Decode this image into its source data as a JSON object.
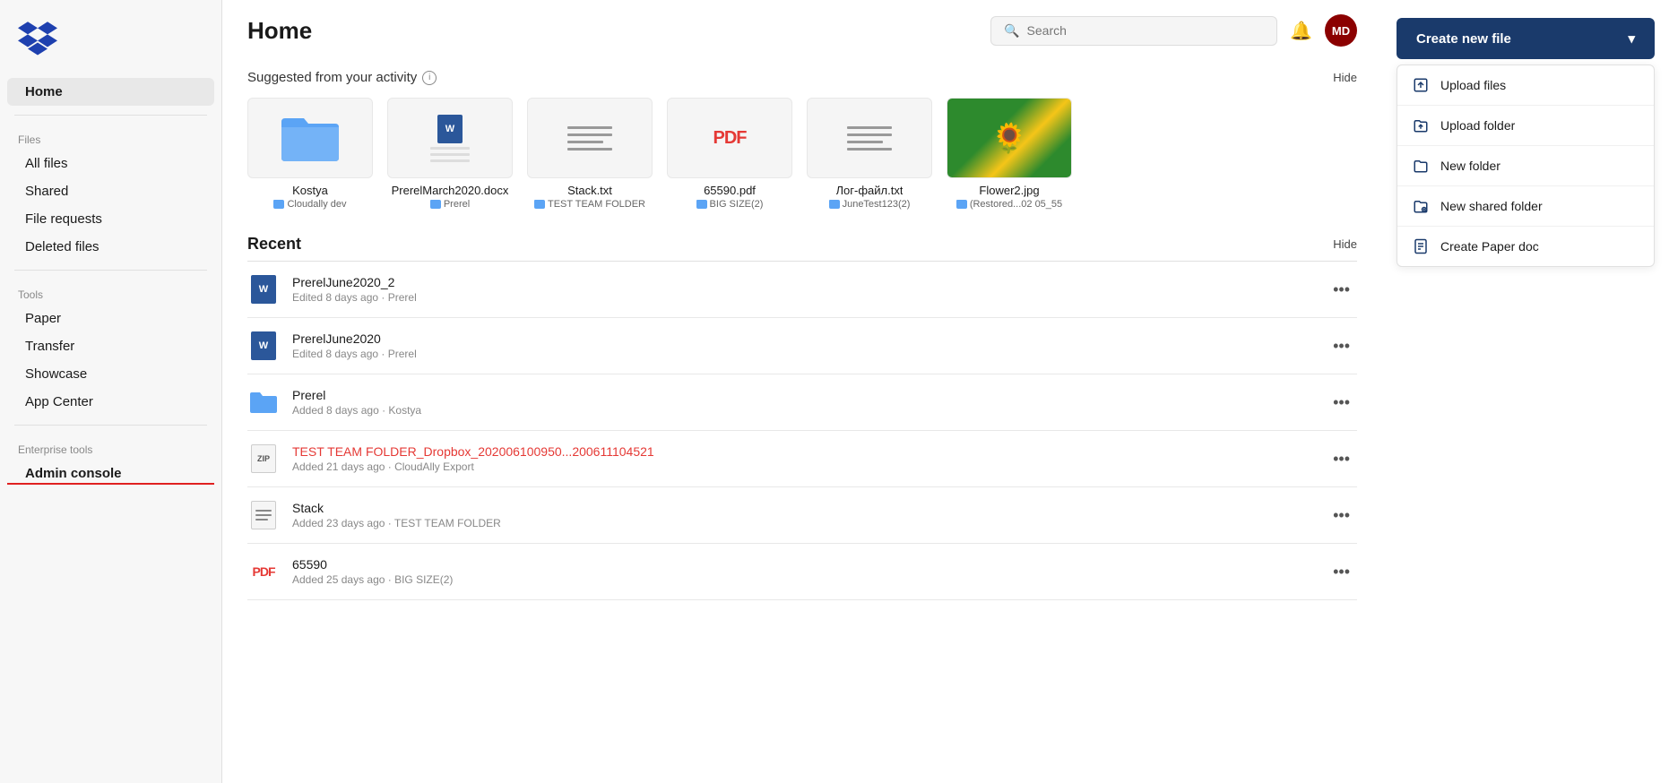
{
  "sidebar": {
    "logo_alt": "Dropbox logo",
    "home_label": "Home",
    "files_section": "Files",
    "items": [
      {
        "id": "all-files",
        "label": "All files"
      },
      {
        "id": "shared",
        "label": "Shared"
      },
      {
        "id": "file-requests",
        "label": "File requests"
      },
      {
        "id": "deleted-files",
        "label": "Deleted files"
      }
    ],
    "tools_section": "Tools",
    "tools": [
      {
        "id": "paper",
        "label": "Paper"
      },
      {
        "id": "transfer",
        "label": "Transfer"
      },
      {
        "id": "showcase",
        "label": "Showcase"
      },
      {
        "id": "app-center",
        "label": "App Center"
      }
    ],
    "enterprise_section": "Enterprise tools",
    "enterprise": [
      {
        "id": "admin-console",
        "label": "Admin console"
      }
    ]
  },
  "topbar": {
    "page_title": "Home",
    "search_placeholder": "Search",
    "avatar_initials": "MD",
    "avatar_color": "#8b0000"
  },
  "suggested": {
    "section_title": "Suggested from your activity",
    "hide_label": "Hide",
    "files": [
      {
        "id": "kostya",
        "name": "Kostya",
        "location": "Cloudally dev",
        "type": "folder"
      },
      {
        "id": "prerel-march",
        "name": "PrerelMarch2020.docx",
        "location": "Prerel",
        "type": "docx"
      },
      {
        "id": "stack-txt",
        "name": "Stack.txt",
        "location": "TEST TEAM FOLDER",
        "type": "txt"
      },
      {
        "id": "pdf-65590",
        "name": "65590.pdf",
        "location": "BIG SIZE(2)",
        "type": "pdf"
      },
      {
        "id": "log-file",
        "name": "Лог-файл.txt",
        "location": "JuneTest123(2)",
        "type": "txt"
      },
      {
        "id": "flower2",
        "name": "Flower2.jpg",
        "location": "(Restored...02 05_55",
        "type": "jpg"
      }
    ]
  },
  "recent": {
    "section_title": "Recent",
    "hide_label": "Hide",
    "items": [
      {
        "id": "prerel-june-2",
        "name": "PrerelJune2020_2",
        "meta": "Edited 8 days ago · Prerel",
        "type": "docx"
      },
      {
        "id": "prerel-june",
        "name": "PrerelJune2020",
        "meta": "Edited 8 days ago · Prerel",
        "type": "docx"
      },
      {
        "id": "prerel-folder",
        "name": "Prerel",
        "meta": "Added 8 days ago · Kostya",
        "type": "folder"
      },
      {
        "id": "test-team-folder",
        "name": "TEST TEAM FOLDER_Dropbox_202006100950...200611104521",
        "meta": "Added 21 days ago · CloudAlly Export",
        "type": "zip",
        "name_color": "#e53935"
      },
      {
        "id": "stack",
        "name": "Stack",
        "meta": "Added 23 days ago · TEST TEAM FOLDER",
        "type": "txt"
      },
      {
        "id": "65590",
        "name": "65590",
        "meta": "Added 25 days ago · BIG SIZE(2)",
        "type": "pdf"
      }
    ]
  },
  "create_panel": {
    "create_btn_label": "Create new file",
    "chevron": "▾",
    "items": [
      {
        "id": "upload-files",
        "label": "Upload files",
        "icon": "upload-file"
      },
      {
        "id": "upload-folder",
        "label": "Upload folder",
        "icon": "upload-folder"
      },
      {
        "id": "new-folder",
        "label": "New folder",
        "icon": "folder-plus"
      },
      {
        "id": "new-shared-folder",
        "label": "New shared folder",
        "icon": "shared-folder"
      },
      {
        "id": "create-paper-doc",
        "label": "Create Paper doc",
        "icon": "paper-doc"
      }
    ]
  }
}
